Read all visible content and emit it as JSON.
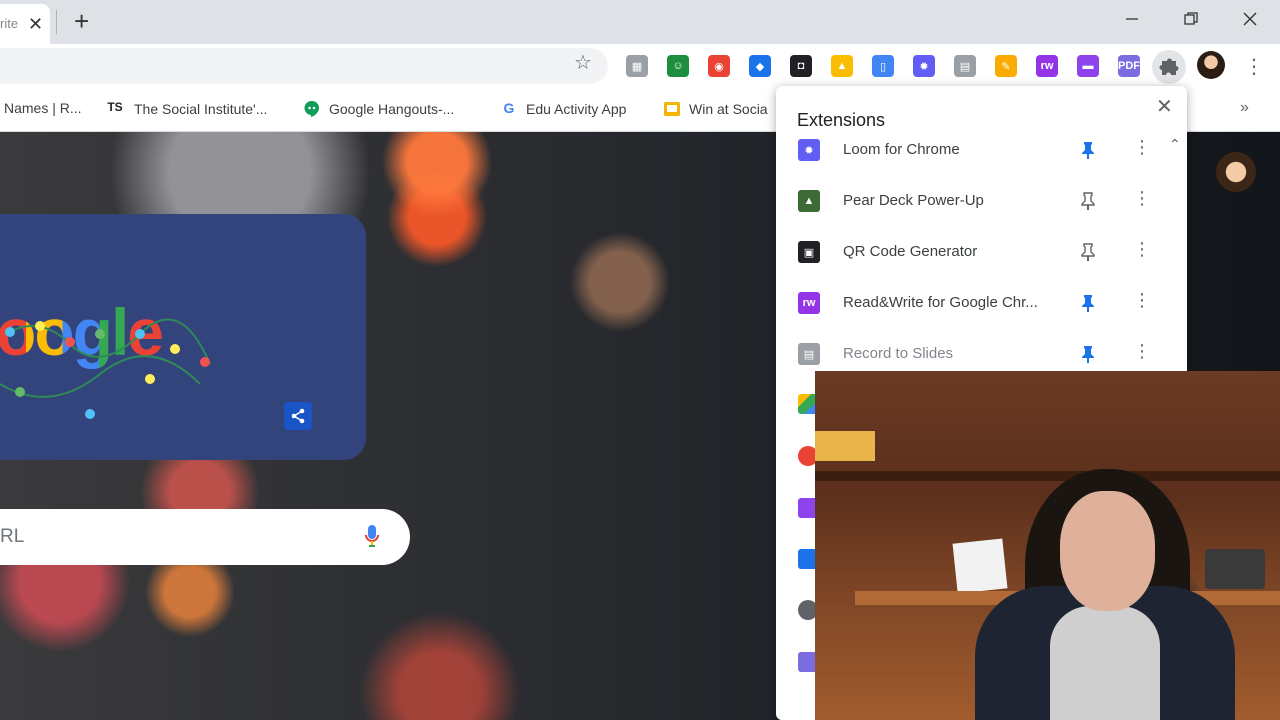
{
  "tabstrip": {
    "active_tab_title": "rite",
    "close_glyph": "✕",
    "new_tab_glyph": "+",
    "window_controls": {
      "minimize": "—",
      "maximize": "❐",
      "close": "✕"
    }
  },
  "toolbar": {
    "bookmark_star": "☆",
    "menu_glyph": "⋮",
    "extension_icons": [
      {
        "name": "save-to-drive-icon",
        "color": "#9aa0a6",
        "glyph": "▦"
      },
      {
        "name": "google-classroom-icon",
        "color": "#1e8e3e",
        "glyph": "☺"
      },
      {
        "name": "color-picker-icon",
        "color": "#ea4335",
        "glyph": "◉"
      },
      {
        "name": "diigo-icon",
        "color": "#1a73e8",
        "glyph": "◆"
      },
      {
        "name": "screencast-icon",
        "color": "#202124",
        "glyph": "◘"
      },
      {
        "name": "google-drive-icon",
        "color": "#fbbc04",
        "glyph": "▲"
      },
      {
        "name": "google-docs-icon",
        "color": "#4285f4",
        "glyph": "▯"
      },
      {
        "name": "loom-icon",
        "color": "#625df5",
        "glyph": "✹"
      },
      {
        "name": "record-to-slides-icon",
        "color": "#9aa0a6",
        "glyph": "▤"
      },
      {
        "name": "google-keep-icon",
        "color": "#f9ab00",
        "glyph": "✎"
      },
      {
        "name": "read-write-icon",
        "color": "#9334e6",
        "glyph": "rw"
      },
      {
        "name": "speech-bubble-icon",
        "color": "#8e44ec",
        "glyph": "▬"
      },
      {
        "name": "pdf-icon",
        "color": "#7b6ce0",
        "glyph": "PDF"
      }
    ]
  },
  "bookmarks": [
    {
      "label": "Names | R...",
      "icon": ""
    },
    {
      "label": "The Social Institute'...",
      "icon": "TS"
    },
    {
      "label": "Google Hangouts-...",
      "icon": "💬"
    },
    {
      "label": "Edu Activity App",
      "icon": "G"
    },
    {
      "label": "Win at Socia",
      "icon": "▭"
    }
  ],
  "bookmarks_more": "»",
  "page": {
    "doodle_letters": "oogle",
    "search_placeholder": "RL",
    "share_glyph": "⤴"
  },
  "extensions_panel": {
    "heading": "Extensions",
    "close_glyph": "✕",
    "scroll_glyph": "⌃",
    "items": [
      {
        "name": "Loom for Chrome",
        "pinned": true,
        "icon_color": "#625df5",
        "icon_glyph": "✹"
      },
      {
        "name": "Pear Deck Power-Up",
        "pinned": false,
        "icon_color": "#3d6b35",
        "icon_glyph": "▲"
      },
      {
        "name": "QR Code Generator",
        "pinned": false,
        "icon_color": "#202124",
        "icon_glyph": "▣"
      },
      {
        "name": "Read&Write for Google Chr...",
        "pinned": true,
        "icon_color": "#9334e6",
        "icon_glyph": "rw"
      },
      {
        "name": "Record to Slides",
        "pinned": true,
        "icon_color": "#9aa0a6",
        "icon_glyph": "▤"
      }
    ],
    "menu_glyph": "⋮",
    "pin_color_active": "#1a73e8",
    "pin_color_inactive": "#5f6368"
  }
}
